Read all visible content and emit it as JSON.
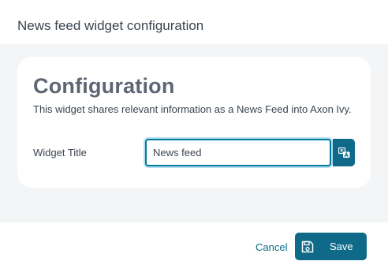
{
  "dialog": {
    "title": "News feed widget configuration"
  },
  "card": {
    "heading": "Configuration",
    "description": "This widget shares relevant information as a News Feed into Axon Ivy."
  },
  "widget_title_field": {
    "label": "Widget Title",
    "value": "News feed",
    "translate_icon": "translate-icon"
  },
  "footer": {
    "cancel_label": "Cancel",
    "save_label": "Save",
    "save_icon": "floppy-disk-icon"
  },
  "colors": {
    "accent": "#0e6a88",
    "focus_border": "#007ba2",
    "heading": "#5d6673",
    "text": "#3b4450",
    "body_background": "#f4f5f7"
  }
}
